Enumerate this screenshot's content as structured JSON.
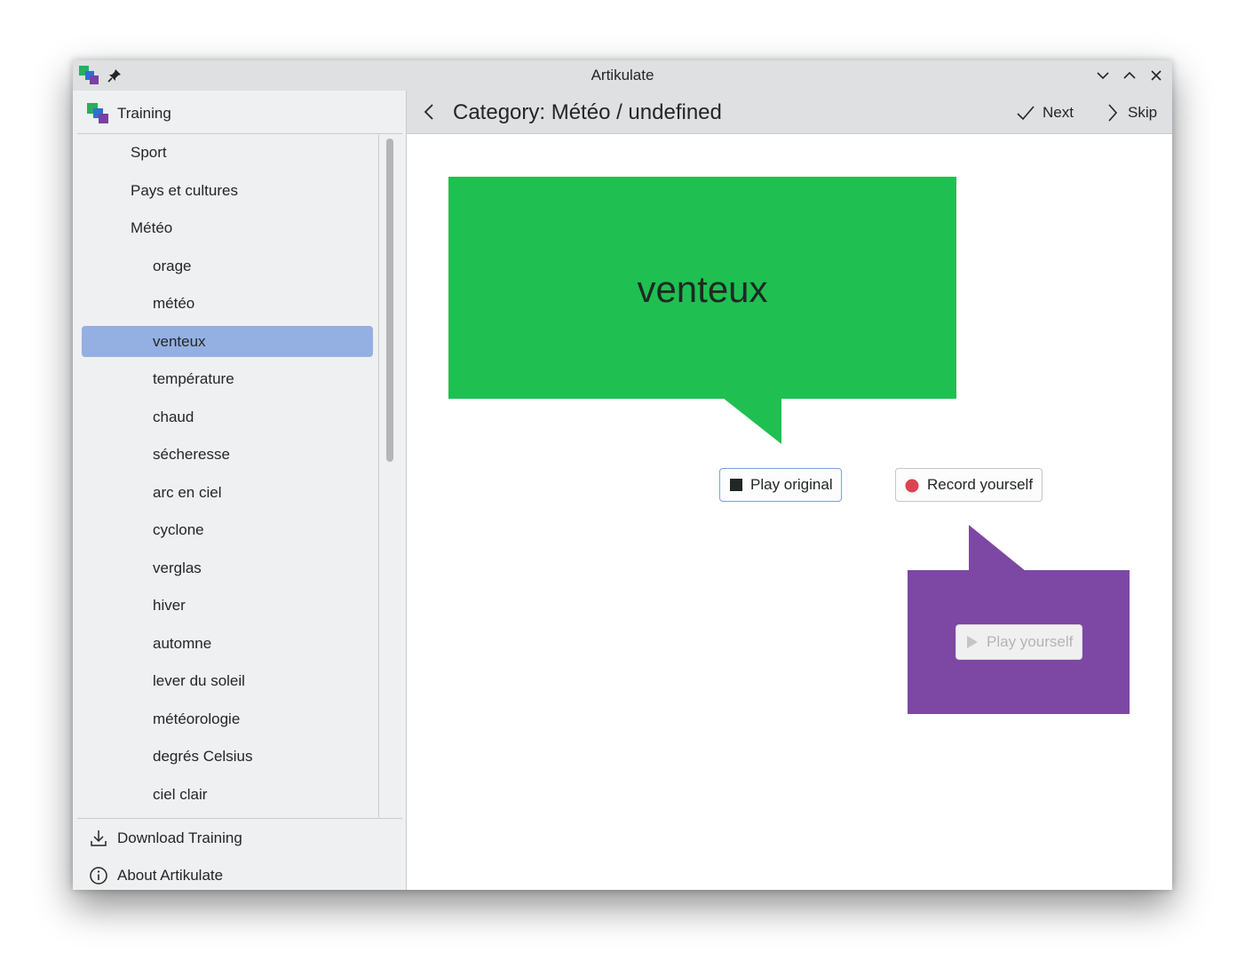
{
  "window": {
    "title": "Artikulate"
  },
  "sidebar": {
    "header_label": "Training",
    "items": [
      {
        "label": "Sport",
        "level": 0
      },
      {
        "label": "Pays et cultures",
        "level": 0
      },
      {
        "label": "Météo",
        "level": 0
      },
      {
        "label": "orage",
        "level": 1
      },
      {
        "label": "météo",
        "level": 1
      },
      {
        "label": "venteux",
        "level": 1,
        "selected": true
      },
      {
        "label": "température",
        "level": 1
      },
      {
        "label": "chaud",
        "level": 1
      },
      {
        "label": "sécheresse",
        "level": 1
      },
      {
        "label": "arc en ciel",
        "level": 1
      },
      {
        "label": "cyclone",
        "level": 1
      },
      {
        "label": "verglas",
        "level": 1
      },
      {
        "label": "hiver",
        "level": 1
      },
      {
        "label": "automne",
        "level": 1
      },
      {
        "label": "lever du soleil",
        "level": 1
      },
      {
        "label": "météorologie",
        "level": 1
      },
      {
        "label": "degrés Celsius",
        "level": 1
      },
      {
        "label": "ciel clair",
        "level": 1
      }
    ],
    "footer": {
      "download_label": "Download Training",
      "about_label": "About Artikulate"
    }
  },
  "header": {
    "title": "Category: Météo / undefined",
    "next_label": "Next",
    "skip_label": "Skip"
  },
  "main": {
    "word": "venteux",
    "play_original_label": "Play original",
    "record_yourself_label": "Record yourself",
    "play_yourself_label": "Play yourself"
  },
  "colors": {
    "original_bubble": "#1fc051",
    "yourself_bubble": "#7d48a4",
    "selection": "#94b0e2",
    "record_dot": "#da4453"
  }
}
